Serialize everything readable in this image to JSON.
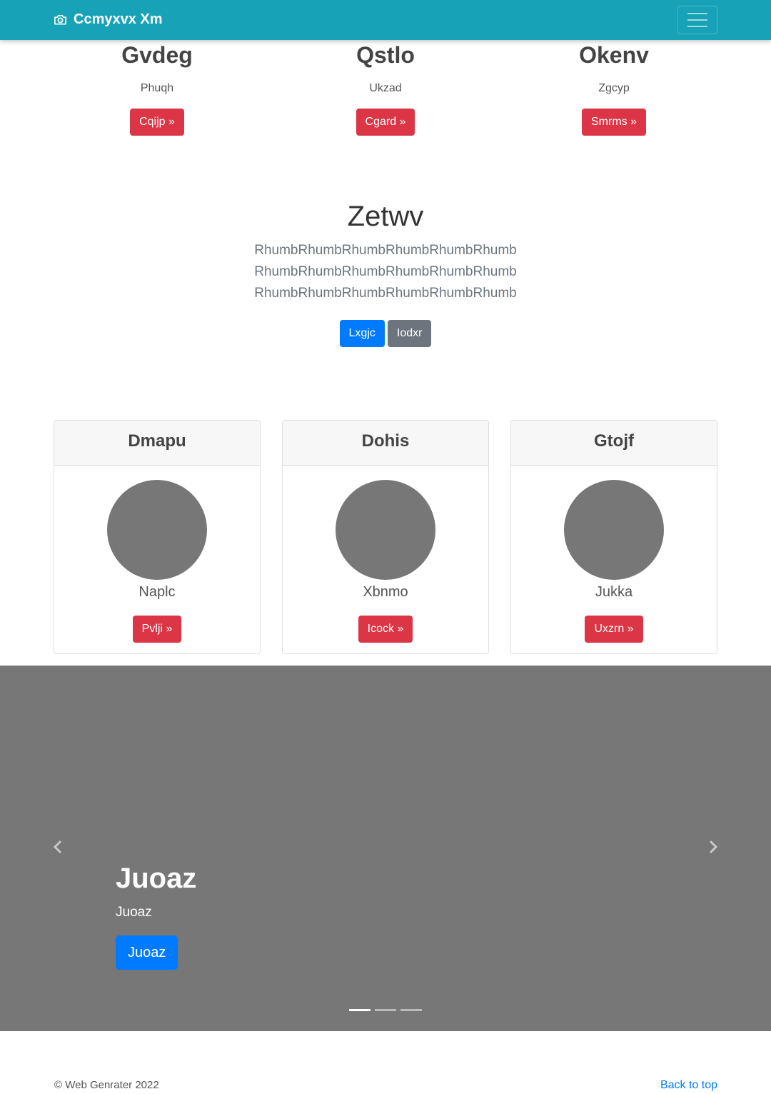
{
  "navbar": {
    "brand": "Ccmyxvx Xm",
    "brand_icon": "camera-icon",
    "toggler_icon": "hamburger-menu-icon",
    "color": "#17a2b8"
  },
  "features": [
    {
      "title": "Gvdeg",
      "text": "Phuqh",
      "button": "Cqijp »"
    },
    {
      "title": "Qstlo",
      "text": "Ukzad",
      "button": "Cgard »"
    },
    {
      "title": "Okenv",
      "text": "Zgcyp",
      "button": "Smrms »"
    }
  ],
  "jumbotron": {
    "heading": "Zetwv",
    "lead": "RhumbRhumbRhumbRhumbRhumbRhumbRhumbRhumbRhumbRhumbRhumbRhumbRhumbRhumbRhumbRhumbRhumbRhumb",
    "primary_button": "Lxgjc",
    "secondary_button": "Iodxr"
  },
  "cards": [
    {
      "header": "Dmapu",
      "text": "Naplc",
      "button": "Pvlji »"
    },
    {
      "header": "Dohis",
      "text": "Xbnmo",
      "button": "Icock »"
    },
    {
      "header": "Gtojf",
      "text": "Jukka",
      "button": "Uxzrn »"
    }
  ],
  "carousel": {
    "heading": "Juoaz",
    "text": "Juoaz",
    "button": "Juoaz",
    "prev_icon": "chevron-left-icon",
    "next_icon": "chevron-right-icon",
    "slides": 3,
    "active_slide": 1
  },
  "footer": {
    "copyright": "© Web Genrater 2022",
    "back_to_top": "Back to top"
  },
  "colors": {
    "danger": "#dc3545",
    "primary": "#007bff",
    "secondary": "#6c757d",
    "placeholder": "#777777"
  }
}
